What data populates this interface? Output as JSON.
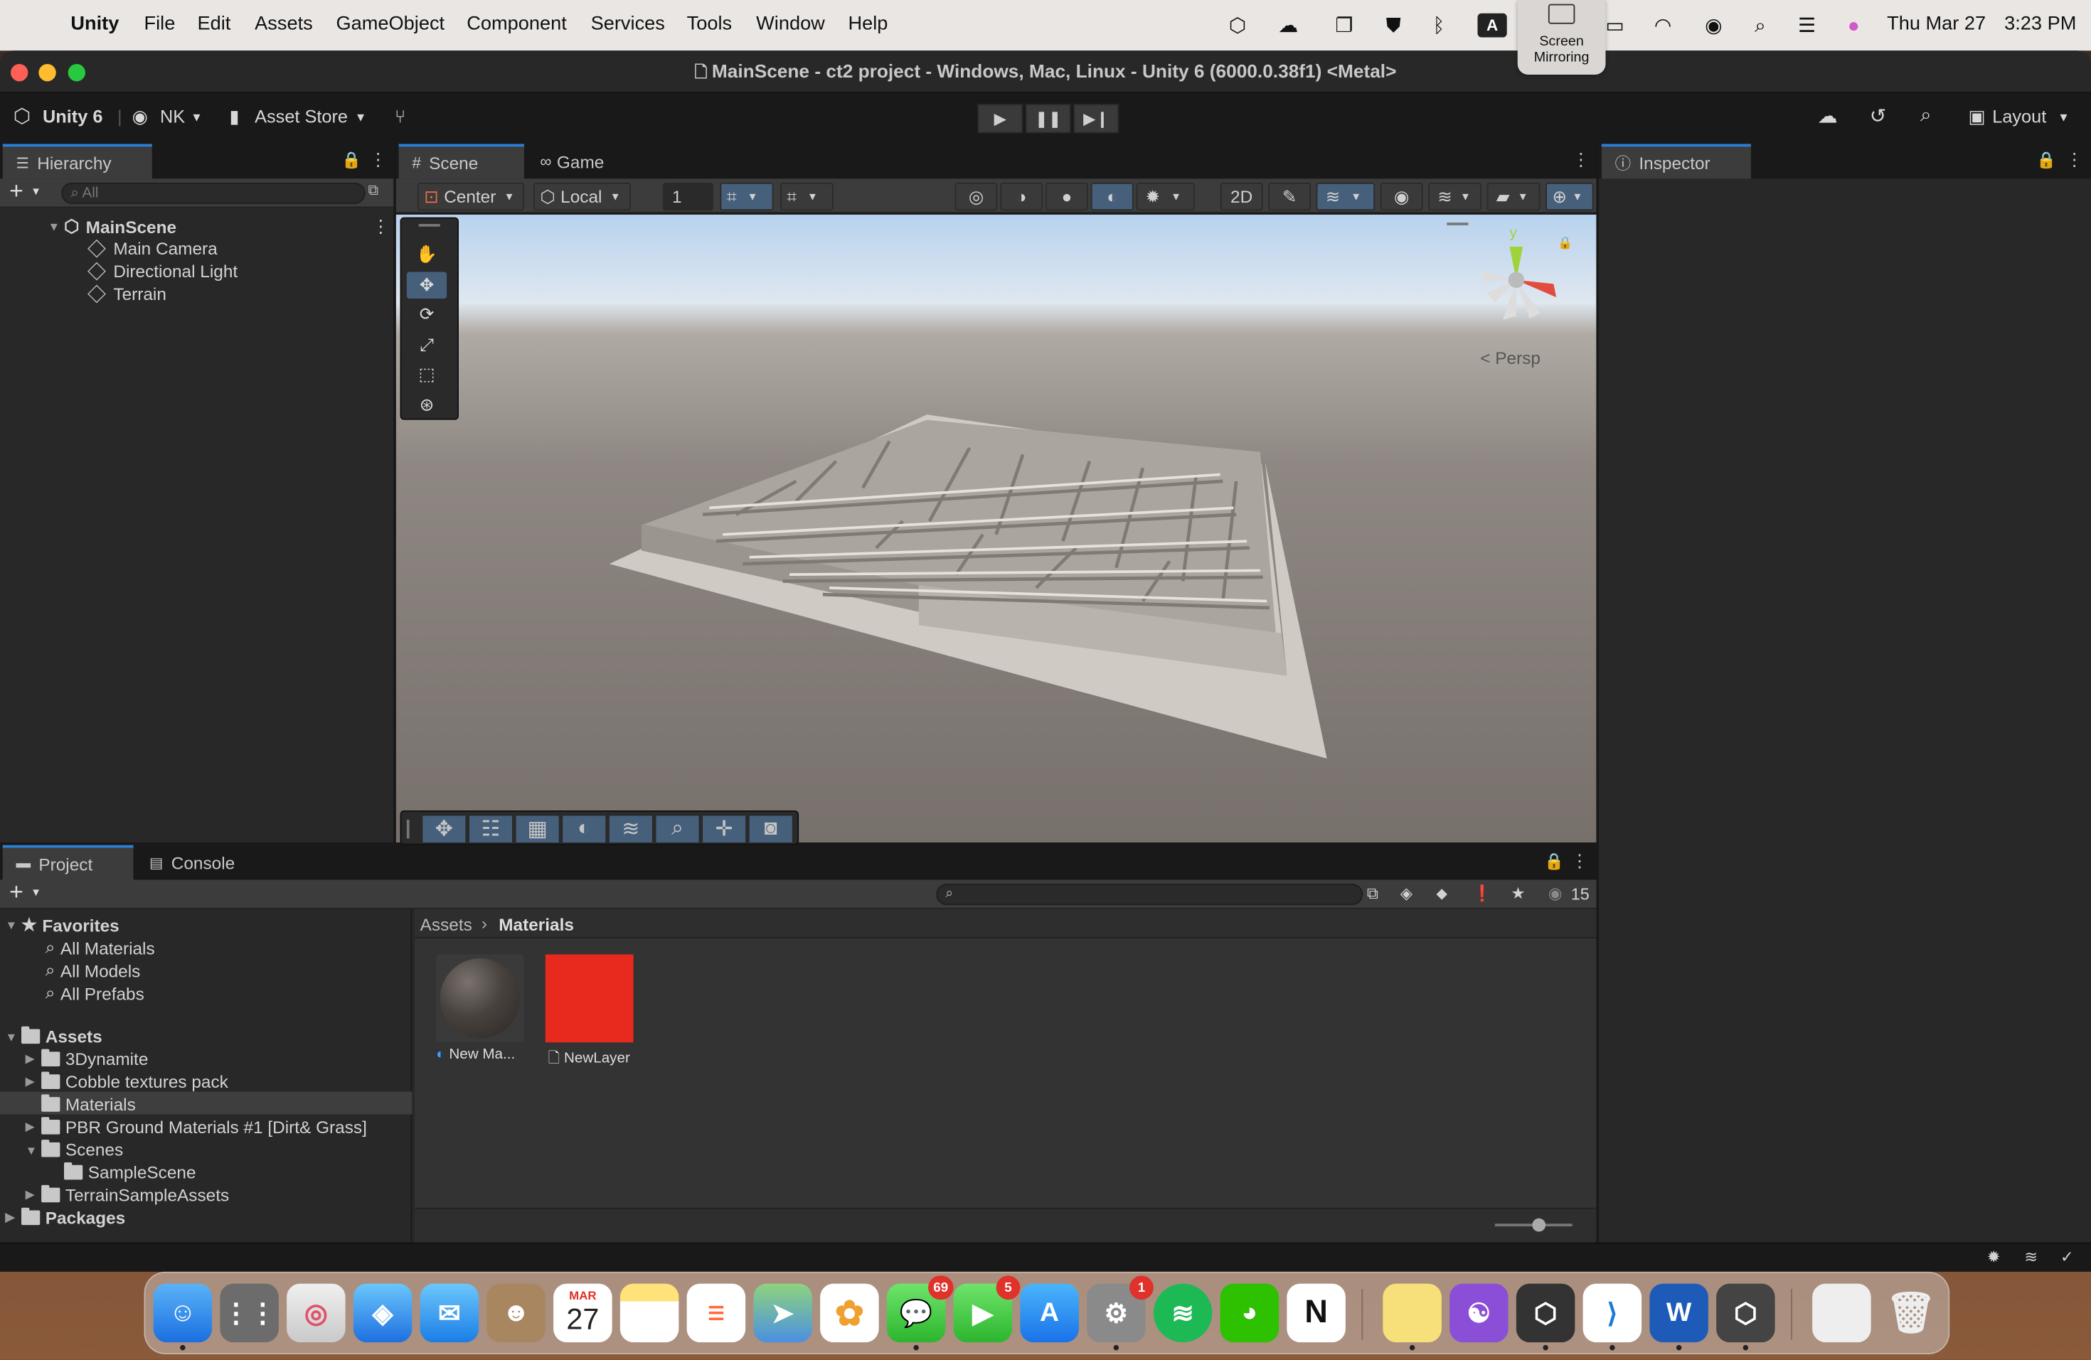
{
  "menubar": {
    "app": "Unity",
    "items": [
      "File",
      "Edit",
      "Assets",
      "GameObject",
      "Component",
      "Services",
      "Tools",
      "Window",
      "Help"
    ],
    "date": "Thu Mar 27",
    "time": "3:23 PM",
    "input_source": "A",
    "screen_mirroring": "Screen Mirroring"
  },
  "window": {
    "title": "MainScene - ct2 project - Windows, Mac, Linux - Unity 6 (6000.0.38f1) <Metal>"
  },
  "toolbar": {
    "unity_label": "Unity 6",
    "account": "NK",
    "asset_store": "Asset Store",
    "layout": "Layout"
  },
  "hierarchy": {
    "tab": "Hierarchy",
    "search_placeholder": "All",
    "scene": "MainScene",
    "objects": [
      "Main Camera",
      "Directional Light",
      "Terrain"
    ]
  },
  "scene_view": {
    "tabs": [
      "Scene",
      "Game"
    ],
    "pivot": "Center",
    "space": "Local",
    "grid_size": "1",
    "persp": "Persp",
    "gizmo_axis": "y"
  },
  "inspector": {
    "tab": "Inspector"
  },
  "project": {
    "tabs": [
      "Project",
      "Console"
    ],
    "favorites_label": "Favorites",
    "favorites": [
      "All Materials",
      "All Models",
      "All Prefabs"
    ],
    "assets_label": "Assets",
    "folders": [
      "3Dynamite",
      "Cobble textures pack",
      "Materials",
      "PBR Ground Materials #1 [Dirt& Grass]",
      "Scenes",
      "SampleScene",
      "TerrainSampleAssets"
    ],
    "packages_label": "Packages",
    "breadcrumb": [
      "Assets",
      "Materials"
    ],
    "hidden_count": "15",
    "assets": [
      {
        "name": "New Ma...",
        "kind": "material"
      },
      {
        "name": "NewLayer",
        "kind": "layer",
        "color": "#e8291e"
      }
    ]
  },
  "dock": {
    "calendar_month": "MAR",
    "calendar_day": "27",
    "messages_badge": "69",
    "facetime_badge": "5",
    "settings_badge": "1"
  },
  "colors": {
    "accent": "#2a7fd6",
    "selected": "#46607c",
    "red_asset": "#e8291e"
  }
}
